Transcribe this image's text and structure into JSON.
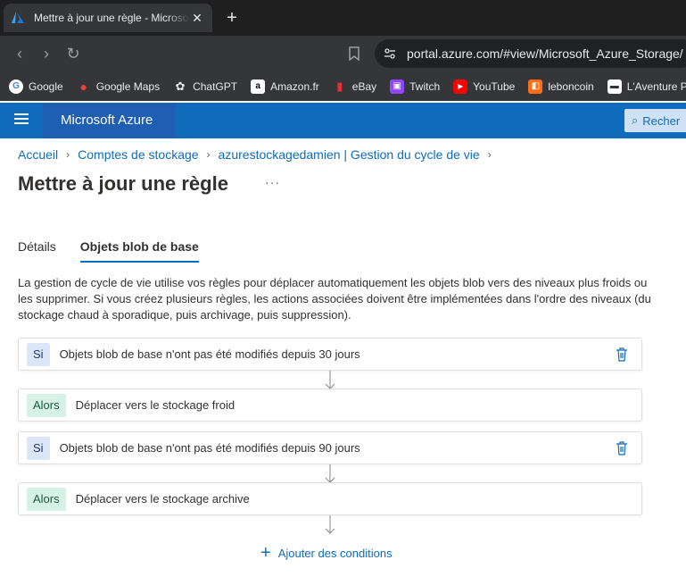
{
  "browser": {
    "tab_title": "Mettre à jour une règle - Microsoft Azure",
    "url": "portal.azure.com/#view/Microsoft_Azure_Storage/",
    "bookmarks": [
      {
        "label": "Google",
        "icon": "google-icon"
      },
      {
        "label": "Google Maps",
        "icon": "maps-icon"
      },
      {
        "label": "ChatGPT",
        "icon": "chatgpt-icon"
      },
      {
        "label": "Amazon.fr",
        "icon": "amazon-icon"
      },
      {
        "label": "eBay",
        "icon": "ebay-icon"
      },
      {
        "label": "Twitch",
        "icon": "twitch-icon"
      },
      {
        "label": "YouTube",
        "icon": "youtube-icon"
      },
      {
        "label": "leboncoin",
        "icon": "leboncoin-icon"
      },
      {
        "label": "L'Aventure Pa",
        "icon": "aventure-icon"
      }
    ]
  },
  "azure": {
    "brand": "Microsoft Azure",
    "search_label": "Recher"
  },
  "breadcrumb": {
    "items": [
      "Accueil",
      "Comptes de stockage",
      "azurestockagedamien | Gestion du cycle de vie"
    ]
  },
  "page": {
    "title": "Mettre à jour une règle",
    "more": "···",
    "tabs": [
      {
        "label": "Détails",
        "active": false
      },
      {
        "label": "Objets blob de base",
        "active": true
      }
    ],
    "description": "La gestion de cycle de vie utilise vos règles pour déplacer automatiquement les objets blob vers des niveaux plus froids ou les supprimer. Si vous créez plusieurs règles, les actions associées doivent être implémentées dans l'ordre des niveaux (du stockage chaud à sporadique, puis archivage, puis suppression).",
    "rules": [
      {
        "badge": "Si",
        "text": "Objets blob de base n'ont pas été modifiés depuis 30 jours"
      },
      {
        "badge": "Alors",
        "text": "Déplacer vers le stockage froid"
      },
      {
        "badge": "Si",
        "text": "Objets blob de base n'ont pas été modifiés depuis 90 jours"
      },
      {
        "badge": "Alors",
        "text": "Déplacer vers le stockage archive"
      }
    ],
    "add_conditions": "Ajouter des conditions"
  },
  "colors": {
    "azure_blue": "#0f6cbd",
    "si_badge": "#dbe6f9",
    "alors_badge": "#d6f1e6"
  }
}
